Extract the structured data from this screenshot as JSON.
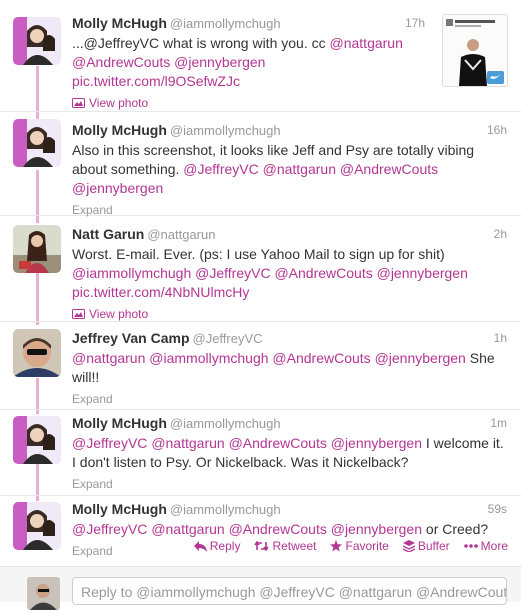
{
  "tweets": [
    {
      "name": "Molly McHugh",
      "handle": "@iammollymchugh",
      "time": "17h",
      "segments": [
        {
          "t": "text",
          "v": "...@JeffreyVC what is wrong with you. cc "
        },
        {
          "t": "mention",
          "v": "@nattgarun"
        },
        {
          "t": "text",
          "v": " "
        },
        {
          "t": "mention",
          "v": "@AndrewCouts"
        },
        {
          "t": "text",
          "v": " "
        },
        {
          "t": "mention",
          "v": "@jennybergen"
        },
        {
          "t": "text",
          "v": " "
        },
        {
          "t": "url",
          "v": "pic.twitter.com/l9OSefwZJc"
        }
      ],
      "action": "View photo",
      "action_icon": "photo-icon"
    },
    {
      "name": "Molly McHugh",
      "handle": "@iammollymchugh",
      "time": "16h",
      "segments": [
        {
          "t": "text",
          "v": "Also in this screenshot, it looks like Jeff and Psy are totally vibing about something. "
        },
        {
          "t": "mention",
          "v": "@JeffreyVC"
        },
        {
          "t": "text",
          "v": " "
        },
        {
          "t": "mention",
          "v": "@nattgarun"
        },
        {
          "t": "text",
          "v": " "
        },
        {
          "t": "mention",
          "v": "@AndrewCouts"
        },
        {
          "t": "text",
          "v": " "
        },
        {
          "t": "mention",
          "v": "@jennybergen"
        }
      ],
      "action": "Expand"
    },
    {
      "name": "Natt Garun",
      "handle": "@nattgarun",
      "time": "2h",
      "segments": [
        {
          "t": "text",
          "v": "Worst. E-mail. Ever. (ps: I use Yahoo Mail to sign up for shit) "
        },
        {
          "t": "mention",
          "v": "@iammollymchugh"
        },
        {
          "t": "text",
          "v": " "
        },
        {
          "t": "mention",
          "v": "@JeffreyVC"
        },
        {
          "t": "text",
          "v": " "
        },
        {
          "t": "mention",
          "v": "@AndrewCouts"
        },
        {
          "t": "text",
          "v": " "
        },
        {
          "t": "mention",
          "v": "@jennybergen"
        },
        {
          "t": "text",
          "v": " "
        },
        {
          "t": "url",
          "v": "pic.twitter.com/4NbNUlmcHy"
        }
      ],
      "action": "View photo",
      "action_icon": "photo-icon"
    },
    {
      "name": "Jeffrey Van Camp",
      "handle": "@JeffreyVC",
      "time": "1h",
      "segments": [
        {
          "t": "mention",
          "v": "@nattgarun"
        },
        {
          "t": "text",
          "v": " "
        },
        {
          "t": "mention",
          "v": "@iammollymchugh"
        },
        {
          "t": "text",
          "v": " "
        },
        {
          "t": "mention",
          "v": "@AndrewCouts"
        },
        {
          "t": "text",
          "v": " "
        },
        {
          "t": "mention",
          "v": "@jennybergen"
        },
        {
          "t": "text",
          "v": " She will!!"
        }
      ],
      "action": "Expand"
    },
    {
      "name": "Molly McHugh",
      "handle": "@iammollymchugh",
      "time": "1m",
      "segments": [
        {
          "t": "mention",
          "v": "@JeffreyVC"
        },
        {
          "t": "text",
          "v": " "
        },
        {
          "t": "mention",
          "v": "@nattgarun"
        },
        {
          "t": "text",
          "v": " "
        },
        {
          "t": "mention",
          "v": "@AndrewCouts"
        },
        {
          "t": "text",
          "v": " "
        },
        {
          "t": "mention",
          "v": "@jennybergen"
        },
        {
          "t": "text",
          "v": " I welcome it. I don't listen to Psy. Or Nickelback. Was it Nickelback?"
        }
      ],
      "action": "Expand"
    },
    {
      "name": "Molly McHugh",
      "handle": "@iammollymchugh",
      "time": "59s",
      "segments": [
        {
          "t": "mention",
          "v": "@JeffreyVC"
        },
        {
          "t": "text",
          "v": " "
        },
        {
          "t": "mention",
          "v": "@nattgarun"
        },
        {
          "t": "text",
          "v": " "
        },
        {
          "t": "mention",
          "v": "@AndrewCouts"
        },
        {
          "t": "text",
          "v": " "
        },
        {
          "t": "mention",
          "v": "@jennybergen"
        },
        {
          "t": "text",
          "v": " or Creed?"
        }
      ],
      "action": "Expand"
    }
  ],
  "tweet_actions": {
    "reply": "Reply",
    "retweet": "Retweet",
    "favorite": "Favorite",
    "buffer": "Buffer",
    "more": "More"
  },
  "reply_box": {
    "placeholder": "Reply to @iammollymchugh @JeffreyVC @nattgarun @AndrewCouts ..."
  },
  "colors": {
    "link": "#b33693",
    "thread_line": "#e4b0d7",
    "muted": "#999999"
  }
}
